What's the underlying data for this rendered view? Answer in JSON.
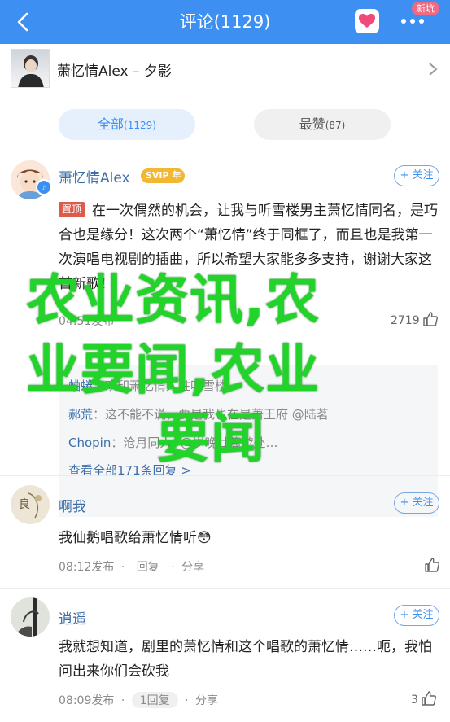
{
  "header": {
    "title": "评论(1129)",
    "badge": "新坑",
    "accent": "#3d8ff2"
  },
  "song": {
    "title": "萧忆情Alex – 夕影"
  },
  "tabs": {
    "all_label": "全部",
    "all_count": "(1129)",
    "hot_label": "最赞",
    "hot_count": "(87)"
  },
  "follow_label": "+ 关注",
  "comments": [
    {
      "user": "萧忆情Alex",
      "vip": "SVIP",
      "pin": "置顶",
      "text": "在一次偶然的机会，让我与听雪楼男主萧忆情同名，是巧合也是缘分！这次两个“萧忆情”终于同框了，而且也是我第一次演唱电视剧的插曲，所以希望大家能多多支持，谢谢大家这首新歌！",
      "meta": "04:51发布",
      "likes": "2719",
      "replies": [
        {
          "name": "蛐蜷",
          "text": "欢印萧忆情入驻听雪楼"
        },
        {
          "name": "郝荒",
          "text": "这不能不说，要是我也在是萧王府 @陆茗"
        },
        {
          "name": "Chopin",
          "text": "沧月同人//@岁晚廿篱游处…"
        }
      ],
      "view_all": "查看全部171条回复 >"
    },
    {
      "user": "啊我",
      "text": "我仙鹅唱歌给萧忆情听😳",
      "time": "08:12发布",
      "reply": "回复",
      "share": "分享",
      "likes": ""
    },
    {
      "user": "逍遥",
      "text": "我就想知道，剧里的萧忆情和这个唱歌的萧忆情……呃，我怕问出来你们会砍我",
      "time": "08:09发布",
      "reply": "1回复",
      "share": "分享",
      "likes": "3"
    }
  ],
  "overlay": {
    "line1": "农业资讯,农",
    "line2": "业要闻,农业",
    "line3": "要闻"
  }
}
